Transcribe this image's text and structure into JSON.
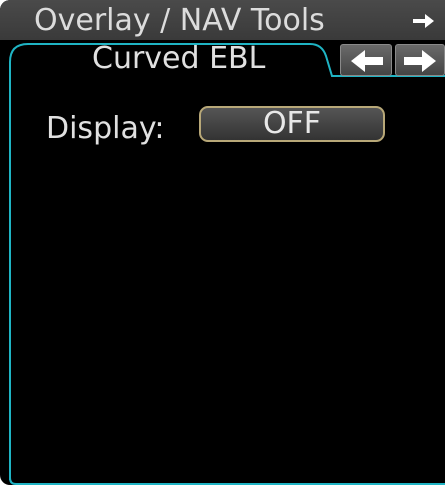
{
  "panel": {
    "title": "Overlay / NAV Tools",
    "header_icon": "arrow-right-icon"
  },
  "tab": {
    "label": "Curved EBL",
    "prev_icon": "arrow-left-icon",
    "next_icon": "arrow-right-icon"
  },
  "display": {
    "label": "Display:",
    "value": "OFF"
  },
  "colors": {
    "frame_accent": "#1fb4c4",
    "button_border": "#b8a878",
    "background": "#000000",
    "header": "#444444"
  }
}
